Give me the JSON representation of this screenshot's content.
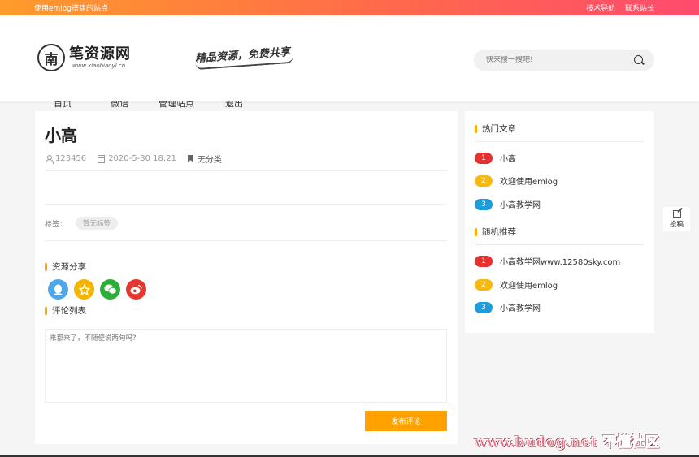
{
  "topbar": {
    "left_text": "使用emlog搭建的站点",
    "links": [
      "技术导航",
      "联系站长"
    ]
  },
  "logo": {
    "icon_char": "南",
    "name": "笔资源网",
    "domain": "www.xiaobiaoyl.cn"
  },
  "slogan": "精品资源，免费共享",
  "search": {
    "placeholder": "快来搜一搜吧!"
  },
  "nav": {
    "items": [
      "首页",
      "微语",
      "管理站点",
      "退出"
    ]
  },
  "article": {
    "title": "小高",
    "author": "123456",
    "date": "2020-5-30 18:21",
    "category": "无分类",
    "tags_label": "标签：",
    "tag": "暂无标签",
    "share_title": "资源分享",
    "comments_title": "评论列表",
    "comment_placeholder": "来都来了，不随便说两句吗?",
    "submit_label": "发布评论"
  },
  "sidebar": {
    "hot_title": "热门文章",
    "hot": [
      {
        "num": "1",
        "title": "小高"
      },
      {
        "num": "2",
        "title": "欢迎使用emlog"
      },
      {
        "num": "3",
        "title": "小高教学网"
      }
    ],
    "random_title": "随机推荐",
    "random": [
      {
        "num": "1",
        "title": "小高教学网www.12580sky.com"
      },
      {
        "num": "2",
        "title": "欢迎使用emlog"
      },
      {
        "num": "3",
        "title": "小高教学网"
      }
    ]
  },
  "float_button": "投稿",
  "watermark": "www.budog.net 不懂社区",
  "colors": {
    "accent": "#ffa200",
    "rank1": "#e8312f",
    "rank2": "#f7b90f",
    "rank3": "#1e9bdb"
  }
}
